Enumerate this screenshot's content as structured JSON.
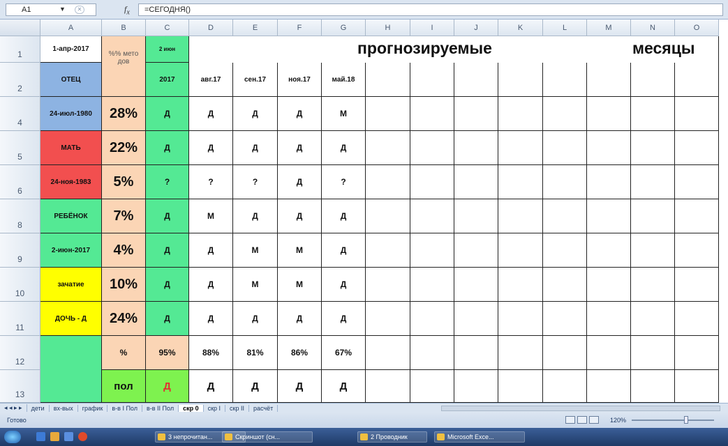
{
  "formula_bar": {
    "cell_ref": "A1",
    "fx": "fx",
    "formula": "=СЕГОДНЯ()"
  },
  "columns": [
    "A",
    "B",
    "C",
    "D",
    "E",
    "F",
    "G",
    "H",
    "I",
    "J",
    "K",
    "L",
    "M",
    "N",
    "O"
  ],
  "rows": [
    "1",
    "2",
    "4",
    "5",
    "6",
    "8",
    "9",
    "10",
    "11",
    "12",
    "13"
  ],
  "header": {
    "a1": "1-апр-2017",
    "b1": "%% мето дов",
    "c1": "2 июн",
    "c2": "2017",
    "forecast": "прогнозируемые",
    "months": "месяцы",
    "a2": "ОТЕЦ",
    "month_cols": [
      "авг.17",
      "сен.17",
      "ноя.17",
      "май.18"
    ]
  },
  "data_rows": [
    {
      "a": "24-июл-1980",
      "b": "28%",
      "c": "Д",
      "d": "Д",
      "e": "Д",
      "f": "Д",
      "g": "М"
    },
    {
      "a": "МАТЬ",
      "b": "22%",
      "c": "Д",
      "d": "Д",
      "e": "Д",
      "f": "Д",
      "g": "Д"
    },
    {
      "a": "24-ноя-1983",
      "b": "5%",
      "c": "?",
      "d": "?",
      "e": "?",
      "f": "Д",
      "g": "?"
    },
    {
      "a": "РЕБЁНОК",
      "b": "7%",
      "c": "Д",
      "d": "М",
      "e": "Д",
      "f": "Д",
      "g": "Д"
    },
    {
      "a": "2-июн-2017",
      "b": "4%",
      "c": "Д",
      "d": "Д",
      "e": "М",
      "f": "М",
      "g": "Д"
    },
    {
      "a": "зачатие",
      "b": "10%",
      "c": "Д",
      "d": "Д",
      "e": "М",
      "f": "М",
      "g": "Д"
    },
    {
      "a": "ДОЧЬ - Д",
      "b": "24%",
      "c": "Д",
      "d": "Д",
      "e": "Д",
      "f": "Д",
      "g": "Д"
    }
  ],
  "summary_row": {
    "b": "%",
    "c": "95%",
    "d": "88%",
    "e": "81%",
    "f": "86%",
    "g": "67%"
  },
  "sex_row": {
    "b": "пол",
    "c": "Д",
    "d": "Д",
    "e": "Д",
    "f": "Д",
    "g": "Д"
  },
  "sheet_tabs": [
    "дети",
    "вх-вых",
    "график",
    "в-в I Пол",
    "в-в II Пол",
    "скр 0",
    "скр I",
    "скр II",
    "расчёт"
  ],
  "active_tab": "скр 0",
  "status": {
    "ready": "Готово",
    "zoom": "120%"
  },
  "taskbar": [
    "3 непрочитан...",
    "Скриншот (сн...",
    "2 Проводник",
    "Microsoft Exce..."
  ],
  "colors": {
    "blue": "#8db3e2",
    "red": "#f24f4f",
    "green": "#54e994",
    "yellow": "#ffff00",
    "peach": "#fbd5b5",
    "lime": "#7ef24f"
  }
}
